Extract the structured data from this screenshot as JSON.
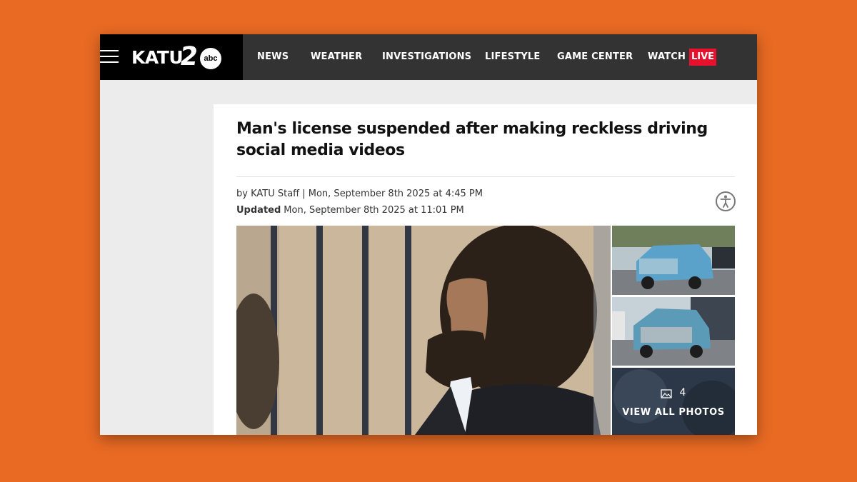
{
  "header": {
    "logo_text": "KATU",
    "logo_number": "2",
    "logo_network": "abc",
    "nav": [
      "NEWS",
      "WEATHER",
      "INVESTIGATIONS",
      "LIFESTYLE",
      "GAME CENTER",
      "WATCH"
    ],
    "live_label": "LIVE"
  },
  "article": {
    "headline": "Man's license suspended after making reckless driving social media videos",
    "byline": "by KATU Staff | Mon, September 8th 2025 at 4:45 PM",
    "updated_label": "Updated",
    "updated_value": "Mon, September 8th 2025 at 11:01 PM"
  },
  "gallery": {
    "photo_count": "4",
    "view_all_label": "VIEW ALL PHOTOS"
  },
  "colors": {
    "background": "#E86A23",
    "live": "#e8112d",
    "header": "#333333"
  },
  "icons": [
    "hamburger-menu-icon",
    "accessibility-icon",
    "image-icon"
  ]
}
